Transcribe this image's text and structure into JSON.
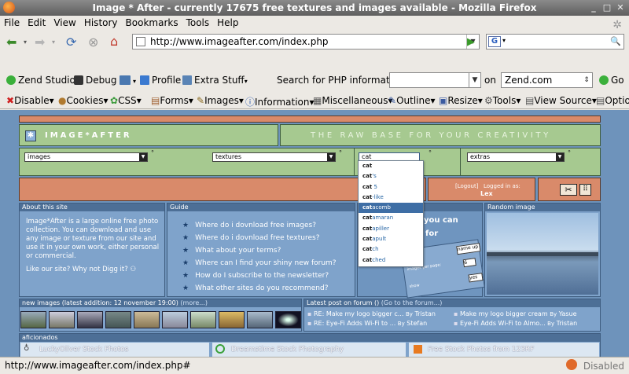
{
  "window": {
    "title": "Image * After - currently 17675 free textures and images available - Mozilla Firefox"
  },
  "menubar": {
    "items": [
      "File",
      "Edit",
      "View",
      "History",
      "Bookmarks",
      "Tools",
      "Help"
    ]
  },
  "navbar": {
    "url": "http://www.imageafter.com/index.php",
    "search_value": ""
  },
  "zendbar": {
    "items": [
      "Zend Studio",
      "Debug",
      "",
      "Profile",
      "Extra Stuff"
    ],
    "search_label": "Search for PHP information:",
    "on_label": "on",
    "engine": "Zend.com",
    "go_label": "Go"
  },
  "webdevbar": {
    "items": [
      "Disable",
      "Cookies",
      "CSS",
      "Forms",
      "Images",
      "Information",
      "Miscellaneous",
      "Outline",
      "Resize",
      "Tools",
      "View Source",
      "Option"
    ]
  },
  "site": {
    "logo_text": "IMAGE*AFTER",
    "tagline": "THE RAW BASE FOR YOUR CREATIVITY",
    "selects": [
      "images",
      "textures",
      "cat",
      "extras"
    ],
    "login": {
      "logout": "[Logout]",
      "logged_in_as": "Logged in as:",
      "user": "Lex"
    },
    "about": {
      "head": "About this site",
      "body": "Image*After is a large online free photo collection. You can download and use any image or texture from our site and use it in your own work, either personal or commercial.",
      "like": "Like our site? Why not Digg it?"
    },
    "guide": {
      "head": "Guide",
      "items": [
        "Where do i dovnload free images?",
        "Where do i dovnload free textures?",
        "What about your terms?",
        "Where can I find your shiny new forum?",
        "How do I subscribe to the newsletter?",
        "What other sites do you recommend?"
      ]
    },
    "middle": {
      "line1": "you can",
      "line2": "for",
      "name_up": "name up",
      "per_page": "images per page:",
      "per_page_val": "6",
      "yes": "yes",
      "show": "show"
    },
    "random_head": "Random image",
    "new_images_head": "new images (latest addition: 12 november 19:00)",
    "more": "(more...)",
    "forum": {
      "head": "Latest post on forum ()",
      "goto": "(Go to the forum...)",
      "posts": [
        {
          "title": "RE: Make my logo bigger c...",
          "by": "By",
          "author": "Tristan"
        },
        {
          "title": "Make my logo bigger cream",
          "by": "By",
          "author": "Yasue"
        },
        {
          "title": "RE: Eye-Fi Adds Wi-Fi to ...",
          "by": "By",
          "author": "Stefan"
        },
        {
          "title": "Eye-Fi Adds Wi-Fi to Almo...",
          "by": "By",
          "author": "Tristan"
        }
      ]
    },
    "aficionados": {
      "head": "aficionados",
      "links": [
        "LuckyOliver Stock Photos",
        "Dreamstime Stock Photography",
        "Free Stock Photos from 123RF"
      ]
    }
  },
  "autocomplete": {
    "input_value": "cat",
    "options": [
      {
        "pre": "cat",
        "post": "",
        "selected": false
      },
      {
        "pre": "cat",
        "post": "'s",
        "selected": false
      },
      {
        "pre": "cat",
        "post": " 5",
        "selected": false
      },
      {
        "pre": "cat",
        "post": "-like",
        "selected": false
      },
      {
        "pre": "cat",
        "post": "acomb",
        "selected": true
      },
      {
        "pre": "cat",
        "post": "amaran",
        "selected": false
      },
      {
        "pre": "cat",
        "post": "apiller",
        "selected": false
      },
      {
        "pre": "cat",
        "post": "apult",
        "selected": false
      },
      {
        "pre": "cat",
        "post": "ch",
        "selected": false
      },
      {
        "pre": "cat",
        "post": "ched",
        "selected": false
      }
    ]
  },
  "status": {
    "text": "http://www.imageafter.com/index.php#",
    "right": "Disabled"
  },
  "colors": {
    "green": "#a6c990",
    "orange": "#d98a6a",
    "pageblue": "#6e93bb",
    "panelhead": "#4d6f96"
  }
}
